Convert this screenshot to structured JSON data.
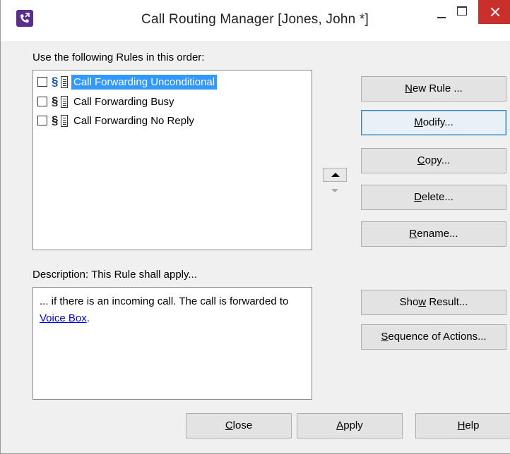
{
  "window": {
    "title": "Call Routing Manager [Jones, John *]"
  },
  "rules": {
    "heading": "Use the following Rules in this order:",
    "items": [
      {
        "label": "Call Forwarding Unconditional",
        "checked": false,
        "selected": true
      },
      {
        "label": "Call Forwarding Busy",
        "checked": false,
        "selected": false
      },
      {
        "label": "Call Forwarding No Reply",
        "checked": false,
        "selected": false
      }
    ],
    "paragraph_symbol": "§"
  },
  "buttons": {
    "new_rule": {
      "pre": "",
      "key": "N",
      "post": "ew Rule ..."
    },
    "modify": {
      "pre": "",
      "key": "M",
      "post": "odify..."
    },
    "copy": {
      "pre": "",
      "key": "C",
      "post": "opy..."
    },
    "delete": {
      "pre": "",
      "key": "D",
      "post": "elete..."
    },
    "rename": {
      "pre": "",
      "key": "R",
      "post": "ename..."
    },
    "show_result": {
      "pre": "Sho",
      "key": "w",
      "post": " Result..."
    },
    "sequence": {
      "pre": "",
      "key": "S",
      "post": "equence of Actions..."
    },
    "close": {
      "pre": "",
      "key": "C",
      "post": "lose"
    },
    "apply": {
      "pre": "",
      "key": "A",
      "post": "pply"
    },
    "help": {
      "pre": "",
      "key": "H",
      "post": "elp"
    }
  },
  "description": {
    "heading": "Description: This Rule shall apply...",
    "text_before": "... if there is an incoming call. The call is forwarded to ",
    "link": "Voice Box",
    "text_after": "."
  },
  "colors": {
    "selection": "#3399ff",
    "close_button": "#c9302c",
    "link": "#0000cc",
    "app_icon": "#5b2d8e"
  }
}
